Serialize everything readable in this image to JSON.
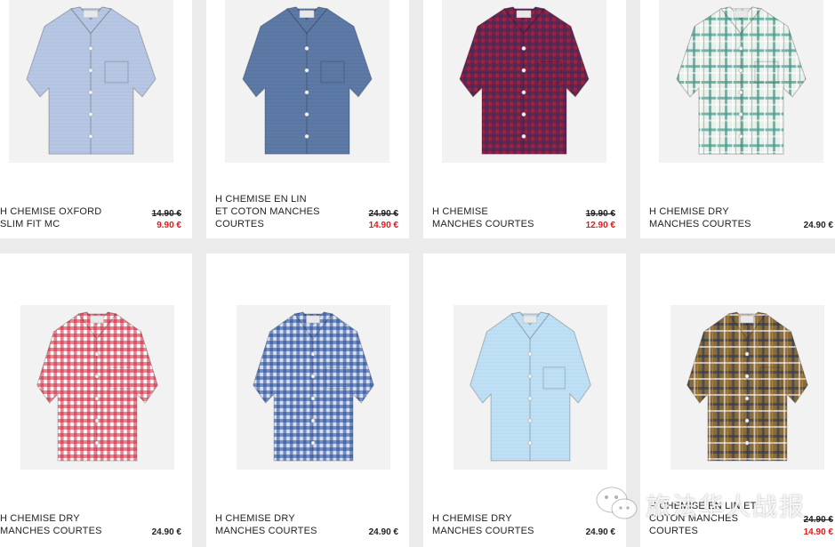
{
  "products": [
    {
      "name": "H CHEMISE OXFORD SLIM FIT MC",
      "old_price": "14.90 €",
      "price": "9.90 €",
      "on_sale": true,
      "colors": {
        "base": "#b7c7e3",
        "line": "#9fb2d4",
        "pattern": "solid"
      }
    },
    {
      "name": "H CHEMISE EN LIN ET COTON MANCHES COURTES",
      "old_price": "24.90 €",
      "price": "14.90 €",
      "on_sale": true,
      "colors": {
        "base": "#5d7aa6",
        "line": "#4c668f",
        "pattern": "solid"
      }
    },
    {
      "name": "H CHEMISE MANCHES COURTES",
      "old_price": "19.90 €",
      "price": "12.90 €",
      "on_sale": true,
      "colors": {
        "base": "#a0203f",
        "line": "#3b2a5a",
        "pattern": "gingham"
      }
    },
    {
      "name": "H CHEMISE DRY MANCHES COURTES",
      "old_price": "",
      "price": "24.90 €",
      "on_sale": false,
      "colors": {
        "base": "#e8f0ea",
        "line": "#3f9c8f",
        "pattern": "plaid"
      }
    },
    {
      "name": "H CHEMISE DRY MANCHES COURTES",
      "old_price": "",
      "price": "24.90 €",
      "on_sale": false,
      "colors": {
        "base": "#ffffff",
        "line": "#d0253a",
        "pattern": "gingham"
      }
    },
    {
      "name": "H CHEMISE DRY MANCHES COURTES",
      "old_price": "",
      "price": "24.90 €",
      "on_sale": false,
      "colors": {
        "base": "#d6e0f2",
        "line": "#234a9a",
        "pattern": "gingham"
      }
    },
    {
      "name": "H CHEMISE DRY MANCHES COURTES",
      "old_price": "",
      "price": "24.90 €",
      "on_sale": false,
      "colors": {
        "base": "#bfe0f4",
        "line": "#a8d1ec",
        "pattern": "solid"
      }
    },
    {
      "name": "H CHEMISE EN LIN ET COTON MANCHES COURTES",
      "old_price": "24.90 €",
      "price": "14.90 €",
      "on_sale": true,
      "colors": {
        "base": "#8a6a3a",
        "line": "#2e3f5a",
        "pattern": "plaid"
      }
    }
  ],
  "watermark": {
    "text": "旅法华人战报",
    "icon": "wechat-icon"
  }
}
